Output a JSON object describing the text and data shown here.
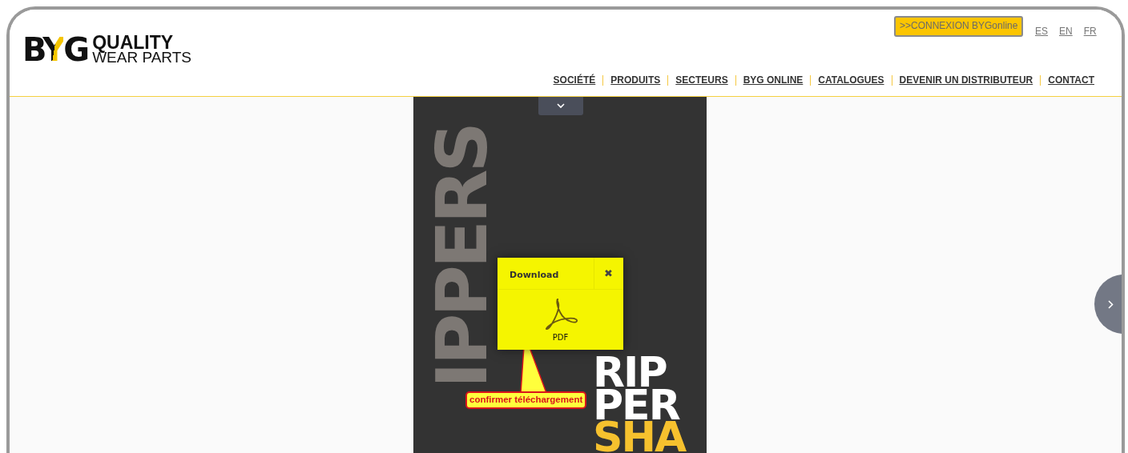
{
  "logo": {
    "mark": "BYG",
    "line_1": "QUALITY",
    "line_2": "WEAR PARTS"
  },
  "login_button": ">>CONNEXION BYGonline",
  "languages": [
    "ES",
    "EN",
    "FR"
  ],
  "nav": [
    "SOCIÉTÉ",
    "PRODUITS",
    "SECTEURS",
    "BYG ONLINE",
    "CATALOGUES",
    "DEVENIR UN DISTRIBUTEUR",
    "CONTACT"
  ],
  "cover": {
    "vertical_texts": [
      "IPPERS"
    ],
    "title_lines": [
      {
        "text": "RIP",
        "color": "#ffffff"
      },
      {
        "text": "PER",
        "color": "#ffffff"
      },
      {
        "text": "SHA",
        "color": "#f6c12e"
      }
    ]
  },
  "download_popup": {
    "title": "Download",
    "close": "✖",
    "file_label": "PDF"
  },
  "callout": "confirmer téléchargement"
}
